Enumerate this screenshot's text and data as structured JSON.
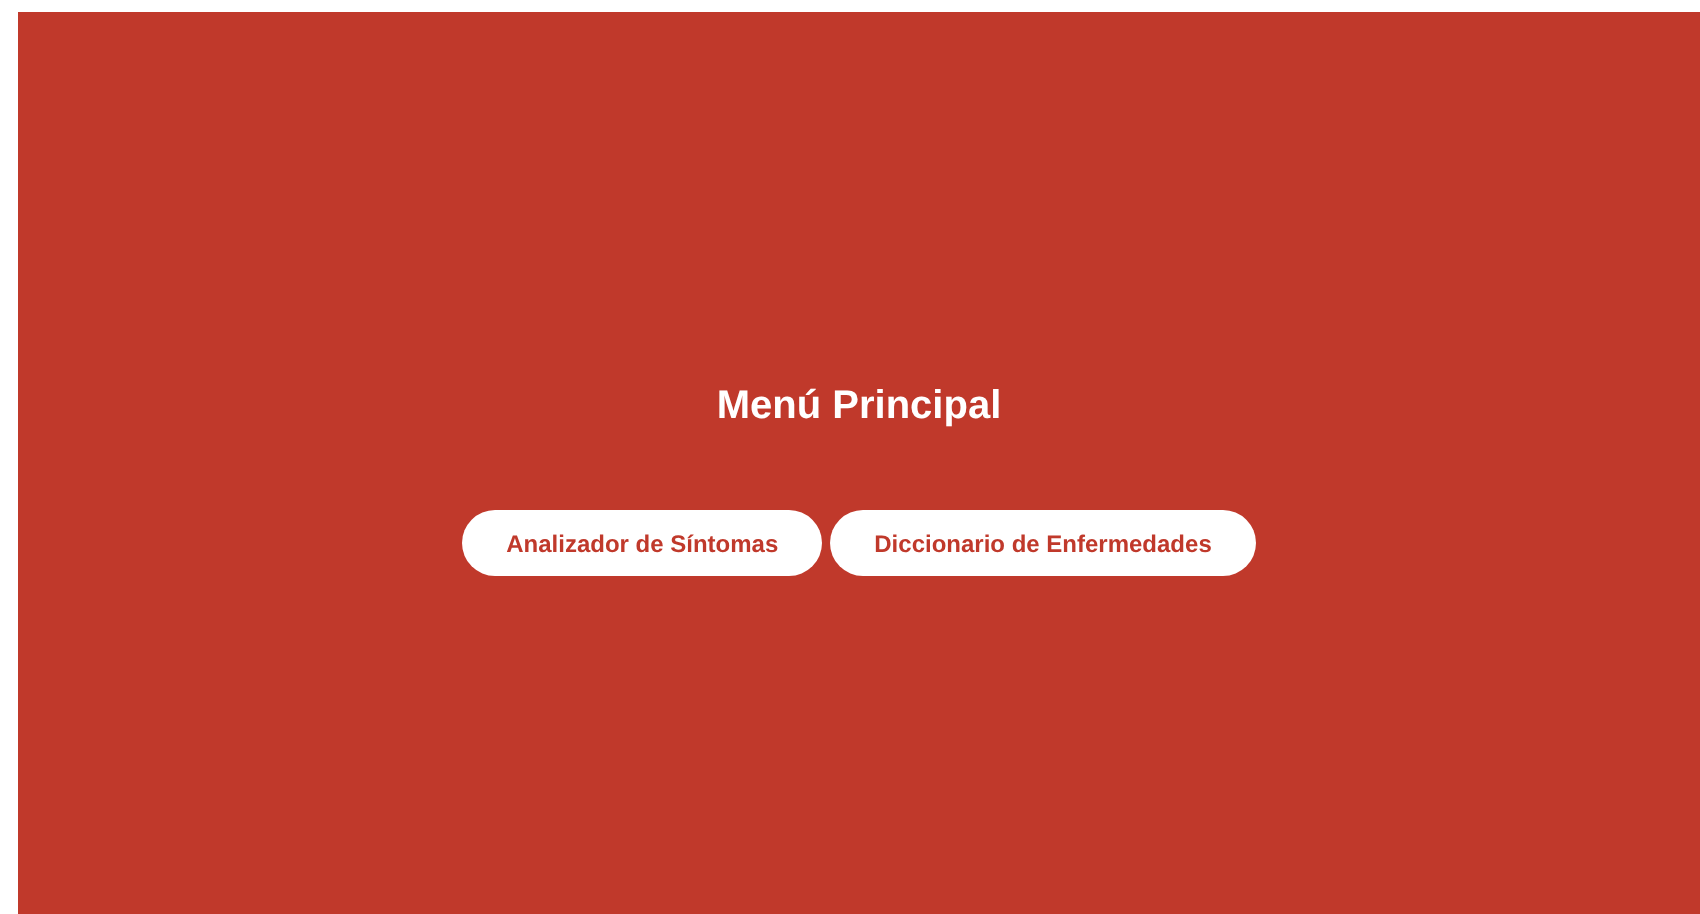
{
  "title": "Menú Principal",
  "buttons": [
    {
      "label": "Analizador de Síntomas"
    },
    {
      "label": "Diccionario de Enfermedades"
    }
  ]
}
